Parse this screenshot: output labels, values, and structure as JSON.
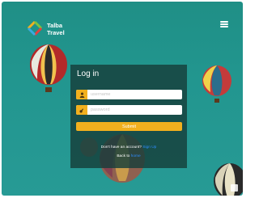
{
  "brand": {
    "name": "Talba\nTravel"
  },
  "header": {
    "menu_icon": "hamburger-menu-icon"
  },
  "login": {
    "title": "Log in",
    "username_placeholder": "username",
    "password_placeholder": "password",
    "username_icon": "user-icon",
    "password_icon": "key-icon",
    "submit_label": "Submit",
    "no_account_text": "Don't have an account?",
    "signup_link": "Sign Up",
    "back_text": "Back to",
    "back_link": "home"
  },
  "colors": {
    "background": "#22968f",
    "card": "#163e3a",
    "accent": "#f2b01e",
    "link": "#2f8cff"
  }
}
